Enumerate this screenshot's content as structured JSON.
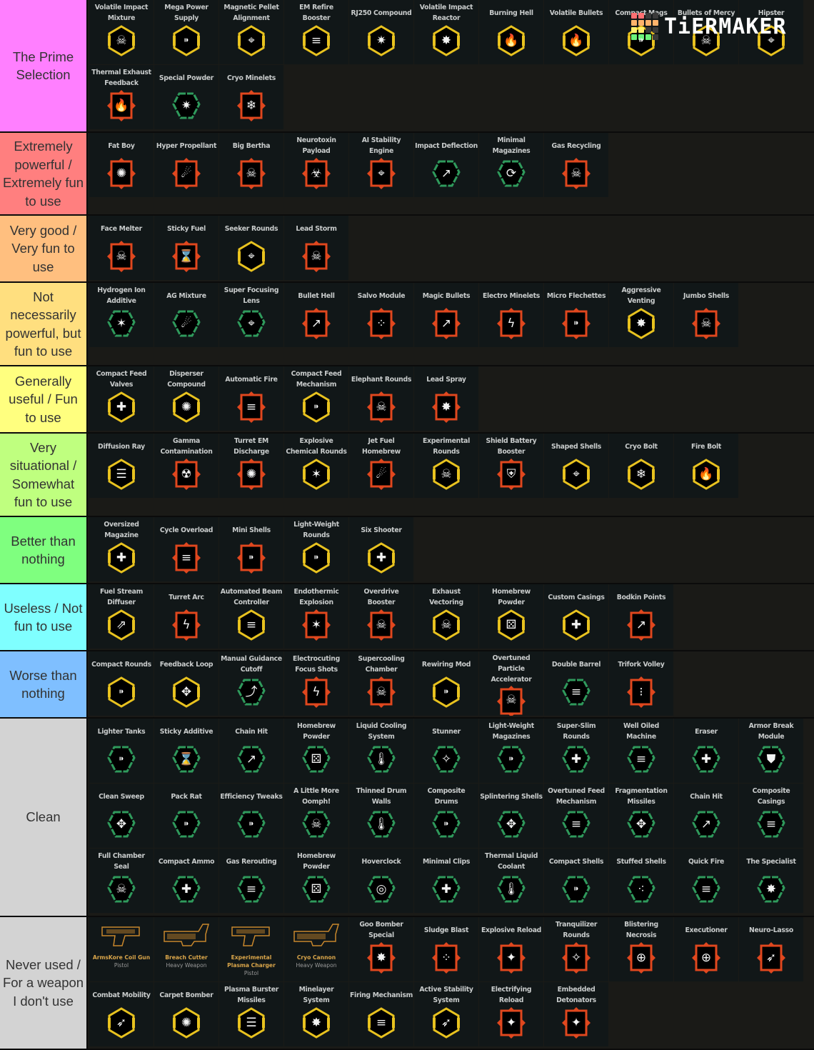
{
  "logo": {
    "text": "TiERMAKER",
    "grid_colors": [
      "#ff6f72",
      "#ff6f72",
      "#3a3a3a",
      "#3a3a3a",
      "#ffb36b",
      "#ffb36b",
      "#ffb36b",
      "#ffb36b",
      "#ffef6b",
      "#ffef6b",
      "#3a3a3a",
      "#3a3a3a",
      "#6bf27a",
      "#6bf27a",
      "#6bf27a",
      "#3a3a3a"
    ]
  },
  "badge_colors": {
    "gold": "#e8c21f",
    "green": "#2f9a5c",
    "red": "#e0471e",
    "weapon": "#c8872c"
  },
  "tiers": [
    {
      "label": "The Prime Selection",
      "color": "#ff7fff",
      "items": [
        {
          "name": "Volatile Impact Mixture",
          "badge": "gold",
          "icon": "skull"
        },
        {
          "name": "Mega Power Supply",
          "badge": "gold",
          "icon": "bullets"
        },
        {
          "name": "Magnetic Pellet Alignment",
          "badge": "gold",
          "icon": "crosshair"
        },
        {
          "name": "EM Refire Booster",
          "badge": "gold",
          "icon": "bullet-spray"
        },
        {
          "name": "RJ250 Compound",
          "badge": "gold",
          "icon": "jump-blast"
        },
        {
          "name": "Volatile Impact Reactor",
          "badge": "gold",
          "icon": "explosion"
        },
        {
          "name": "Burning Hell",
          "badge": "gold",
          "icon": "fire"
        },
        {
          "name": "Volatile Bullets",
          "badge": "gold",
          "icon": "fire"
        },
        {
          "name": "Compact Mags",
          "badge": "gold",
          "icon": "bullets"
        },
        {
          "name": "Bullets of Mercy",
          "badge": "gold",
          "icon": "skull"
        },
        {
          "name": "Hipster",
          "badge": "gold",
          "icon": "crosshair"
        },
        {
          "name": "Thermal Exhaust Feedback",
          "badge": "red",
          "icon": "fire"
        },
        {
          "name": "Special Powder",
          "badge": "green",
          "icon": "jump-blast"
        },
        {
          "name": "Cryo Minelets",
          "badge": "red",
          "icon": "snowflake"
        }
      ]
    },
    {
      "label": "Extremely powerful / Extremely fun to use",
      "color": "#ff7f7f",
      "items": [
        {
          "name": "Fat Boy",
          "badge": "red",
          "icon": "nuke"
        },
        {
          "name": "Hyper Propellant",
          "badge": "red",
          "icon": "comet"
        },
        {
          "name": "Big Bertha",
          "badge": "red",
          "icon": "skull"
        },
        {
          "name": "Neurotoxin Payload",
          "badge": "red",
          "icon": "biohazard"
        },
        {
          "name": "AI Stability Engine",
          "badge": "red",
          "icon": "crosshair"
        },
        {
          "name": "Impact Deflection",
          "badge": "green",
          "icon": "ricochet"
        },
        {
          "name": "Minimal Magazines",
          "badge": "green",
          "icon": "reload"
        },
        {
          "name": "Gas Recycling",
          "badge": "red",
          "icon": "skull"
        }
      ]
    },
    {
      "label": "Very good / Very fun to use",
      "color": "#ffbf7f",
      "items": [
        {
          "name": "Face Melter",
          "badge": "red",
          "icon": "skull"
        },
        {
          "name": "Sticky Fuel",
          "badge": "red",
          "icon": "hourglass"
        },
        {
          "name": "Seeker Rounds",
          "badge": "gold",
          "icon": "crosshair"
        },
        {
          "name": "Lead Storm",
          "badge": "red",
          "icon": "skull"
        }
      ]
    },
    {
      "label": "Not necessarily powerful, but fun to use",
      "color": "#ffdf7f",
      "items": [
        {
          "name": "Hydrogen Ion Additive",
          "badge": "green",
          "icon": "burst"
        },
        {
          "name": "AG Mixture",
          "badge": "green",
          "icon": "comet"
        },
        {
          "name": "Super Focusing Lens",
          "badge": "green",
          "icon": "crosshair"
        },
        {
          "name": "Bullet Hell",
          "badge": "red",
          "icon": "ricochet"
        },
        {
          "name": "Salvo Module",
          "badge": "red",
          "icon": "pellets"
        },
        {
          "name": "Magic Bullets",
          "badge": "red",
          "icon": "ricochet"
        },
        {
          "name": "Electro Minelets",
          "badge": "red",
          "icon": "lightning"
        },
        {
          "name": "Micro Flechettes",
          "badge": "red",
          "icon": "bullets"
        },
        {
          "name": "Aggressive Venting",
          "badge": "gold",
          "icon": "explosion"
        },
        {
          "name": "Jumbo Shells",
          "badge": "red",
          "icon": "skull"
        }
      ]
    },
    {
      "label": "Generally useful / Fun to use",
      "color": "#ffff7f",
      "items": [
        {
          "name": "Compact Feed Valves",
          "badge": "gold",
          "icon": "ammo-plus"
        },
        {
          "name": "Disperser Compound",
          "badge": "gold",
          "icon": "nuke"
        },
        {
          "name": "Automatic Fire",
          "badge": "red",
          "icon": "bullet-spray"
        },
        {
          "name": "Compact Feed Mechanism",
          "badge": "gold",
          "icon": "bullets"
        },
        {
          "name": "Elephant Rounds",
          "badge": "red",
          "icon": "skull"
        },
        {
          "name": "Lead Spray",
          "badge": "red",
          "icon": "explosion"
        }
      ]
    },
    {
      "label": "Very situational / Somewhat fun to use",
      "color": "#bfff7f",
      "items": [
        {
          "name": "Diffusion Ray",
          "badge": "gold",
          "icon": "beam"
        },
        {
          "name": "Gamma Contamination",
          "badge": "red",
          "icon": "radiation"
        },
        {
          "name": "Turret EM Discharge",
          "badge": "red",
          "icon": "nuke"
        },
        {
          "name": "Explosive Chemical Rounds",
          "badge": "gold",
          "icon": "burst"
        },
        {
          "name": "Jet Fuel Homebrew",
          "badge": "red",
          "icon": "comet"
        },
        {
          "name": "Experimental Rounds",
          "badge": "gold",
          "icon": "skull"
        },
        {
          "name": "Shield Battery Booster",
          "badge": "red",
          "icon": "shield"
        },
        {
          "name": "Shaped Shells",
          "badge": "gold",
          "icon": "crosshair"
        },
        {
          "name": "Cryo Bolt",
          "badge": "gold",
          "icon": "snowflake"
        },
        {
          "name": "Fire Bolt",
          "badge": "gold",
          "icon": "fire"
        }
      ]
    },
    {
      "label": "Better than nothing",
      "color": "#7fff7f",
      "items": [
        {
          "name": "Oversized Magazine",
          "badge": "gold",
          "icon": "ammo-plus"
        },
        {
          "name": "Cycle Overload",
          "badge": "red",
          "icon": "bullet-spray"
        },
        {
          "name": "Mini Shells",
          "badge": "red",
          "icon": "bullets"
        },
        {
          "name": "Light-Weight Rounds",
          "badge": "gold",
          "icon": "bullets"
        },
        {
          "name": "Six Shooter",
          "badge": "gold",
          "icon": "ammo-plus"
        }
      ]
    },
    {
      "label": "Useless / Not fun to use",
      "color": "#7fffff",
      "items": [
        {
          "name": "Fuel Stream Diffuser",
          "badge": "gold",
          "icon": "spread"
        },
        {
          "name": "Turret Arc",
          "badge": "red",
          "icon": "lightning"
        },
        {
          "name": "Automated Beam Controller",
          "badge": "gold",
          "icon": "bullet-spray"
        },
        {
          "name": "Endothermic Explosion",
          "badge": "red",
          "icon": "burst"
        },
        {
          "name": "Overdrive Booster",
          "badge": "red",
          "icon": "skull"
        },
        {
          "name": "Exhaust Vectoring",
          "badge": "gold",
          "icon": "skull"
        },
        {
          "name": "Homebrew Powder",
          "badge": "gold",
          "icon": "dice"
        },
        {
          "name": "Custom Casings",
          "badge": "gold",
          "icon": "ammo-plus"
        },
        {
          "name": "Bodkin Points",
          "badge": "red",
          "icon": "ricochet"
        }
      ]
    },
    {
      "label": "Worse than nothing",
      "color": "#7fbfff",
      "items": [
        {
          "name": "Compact Rounds",
          "badge": "gold",
          "icon": "bullets"
        },
        {
          "name": "Feedback Loop",
          "badge": "gold",
          "icon": "arrows-out"
        },
        {
          "name": "Manual Guidance Cutoff",
          "badge": "green",
          "icon": "guided"
        },
        {
          "name": "Electrocuting Focus Shots",
          "badge": "red",
          "icon": "lightning"
        },
        {
          "name": "Supercooling Chamber",
          "badge": "red",
          "icon": "skull"
        },
        {
          "name": "Rewiring Mod",
          "badge": "gold",
          "icon": "bullets"
        },
        {
          "name": "Overtuned Particle Accelerator",
          "badge": "red",
          "icon": "skull"
        },
        {
          "name": "Double Barrel",
          "badge": "green",
          "icon": "bullet-spray"
        },
        {
          "name": "Trifork Volley",
          "badge": "red",
          "icon": "shells"
        }
      ]
    },
    {
      "label": "Clean",
      "color": "#d3d3d3",
      "items": [
        {
          "name": "Lighter Tanks",
          "badge": "green",
          "icon": "bullets"
        },
        {
          "name": "Sticky Additive",
          "badge": "green",
          "icon": "hourglass"
        },
        {
          "name": "Chain Hit",
          "badge": "green",
          "icon": "ricochet"
        },
        {
          "name": "Homebrew Powder",
          "badge": "green",
          "icon": "dice"
        },
        {
          "name": "Liquid Cooling System",
          "badge": "green",
          "icon": "thermometer"
        },
        {
          "name": "Stunner",
          "badge": "green",
          "icon": "stun"
        },
        {
          "name": "Light-Weight Magazines",
          "badge": "green",
          "icon": "bullets"
        },
        {
          "name": "Super-Slim Rounds",
          "badge": "green",
          "icon": "ammo-plus"
        },
        {
          "name": "Well Oiled Machine",
          "badge": "green",
          "icon": "bullet-spray"
        },
        {
          "name": "Eraser",
          "badge": "green",
          "icon": "ammo-plus"
        },
        {
          "name": "Armor Break Module",
          "badge": "green",
          "icon": "armor"
        },
        {
          "name": "Clean Sweep",
          "badge": "green",
          "icon": "arrows-out"
        },
        {
          "name": "Pack Rat",
          "badge": "green",
          "icon": "bullets"
        },
        {
          "name": "Efficiency Tweaks",
          "badge": "green",
          "icon": "bullets"
        },
        {
          "name": "A Little More Oomph!",
          "badge": "green",
          "icon": "skull"
        },
        {
          "name": "Thinned Drum Walls",
          "badge": "green",
          "icon": "thermometer"
        },
        {
          "name": "Composite Drums",
          "badge": "green",
          "icon": "bullets"
        },
        {
          "name": "Splintering Shells",
          "badge": "green",
          "icon": "arrows-out"
        },
        {
          "name": "Overtuned Feed Mechanism",
          "badge": "green",
          "icon": "bullet-spray"
        },
        {
          "name": "Fragmentation Missiles",
          "badge": "green",
          "icon": "arrows-out"
        },
        {
          "name": "Chain Hit",
          "badge": "green",
          "icon": "ricochet"
        },
        {
          "name": "Composite Casings",
          "badge": "green",
          "icon": "bullet-spray"
        },
        {
          "name": "Full Chamber Seal",
          "badge": "green",
          "icon": "skull"
        },
        {
          "name": "Compact Ammo",
          "badge": "green",
          "icon": "ammo-plus"
        },
        {
          "name": "Gas Rerouting",
          "badge": "green",
          "icon": "bullet-spray"
        },
        {
          "name": "Homebrew Powder",
          "badge": "green",
          "icon": "dice"
        },
        {
          "name": "Hoverclock",
          "badge": "green",
          "icon": "hover"
        },
        {
          "name": "Minimal Clips",
          "badge": "green",
          "icon": "ammo-plus"
        },
        {
          "name": "Thermal Liquid Coolant",
          "badge": "green",
          "icon": "thermometer"
        },
        {
          "name": "Compact Shells",
          "badge": "green",
          "icon": "bullets"
        },
        {
          "name": "Stuffed Shells",
          "badge": "green",
          "icon": "shotgun"
        },
        {
          "name": "Quick Fire",
          "badge": "green",
          "icon": "bullet-spray"
        },
        {
          "name": "The Specialist",
          "badge": "green",
          "icon": "explosion"
        }
      ]
    },
    {
      "label": "Never used / For a weapon I don't use",
      "color": "#d3d3d3",
      "items": [
        {
          "name": "ArmsKore Coil Gun",
          "badge": "weapon",
          "icon": "pistol",
          "type": "Pistol"
        },
        {
          "name": "Breach Cutter",
          "badge": "weapon",
          "icon": "heavy",
          "type": "Heavy Weapon"
        },
        {
          "name": "Experimental Plasma Charger",
          "badge": "weapon",
          "icon": "pistol",
          "type": "Pistol"
        },
        {
          "name": "Cryo Cannon",
          "badge": "weapon",
          "icon": "heavy",
          "type": "Heavy Weapon"
        },
        {
          "name": "Goo Bomber Special",
          "badge": "red",
          "icon": "explosion"
        },
        {
          "name": "Sludge Blast",
          "badge": "red",
          "icon": "pellets"
        },
        {
          "name": "Explosive Reload",
          "badge": "red",
          "icon": "mag-spark"
        },
        {
          "name": "Tranquilizer Rounds",
          "badge": "red",
          "icon": "stun"
        },
        {
          "name": "Blistering Necrosis",
          "badge": "red",
          "icon": "target-skull"
        },
        {
          "name": "Executioner",
          "badge": "red",
          "icon": "target-skull"
        },
        {
          "name": "Neuro-Lasso",
          "badge": "red",
          "icon": "dash"
        },
        {
          "name": "Combat Mobility",
          "badge": "gold",
          "icon": "dash"
        },
        {
          "name": "Carpet Bomber",
          "badge": "gold",
          "icon": "nuke"
        },
        {
          "name": "Plasma Burster Missiles",
          "badge": "gold",
          "icon": "beam"
        },
        {
          "name": "Minelayer System",
          "badge": "gold",
          "icon": "explosion"
        },
        {
          "name": "Firing Mechanism",
          "badge": "gold",
          "icon": "bullet-spray"
        },
        {
          "name": "Active Stability System",
          "badge": "gold",
          "icon": "dash"
        },
        {
          "name": "Electrifying Reload",
          "badge": "red",
          "icon": "mag-spark"
        },
        {
          "name": "Embedded Detonators",
          "badge": "red",
          "icon": "mag-spark"
        }
      ]
    }
  ]
}
